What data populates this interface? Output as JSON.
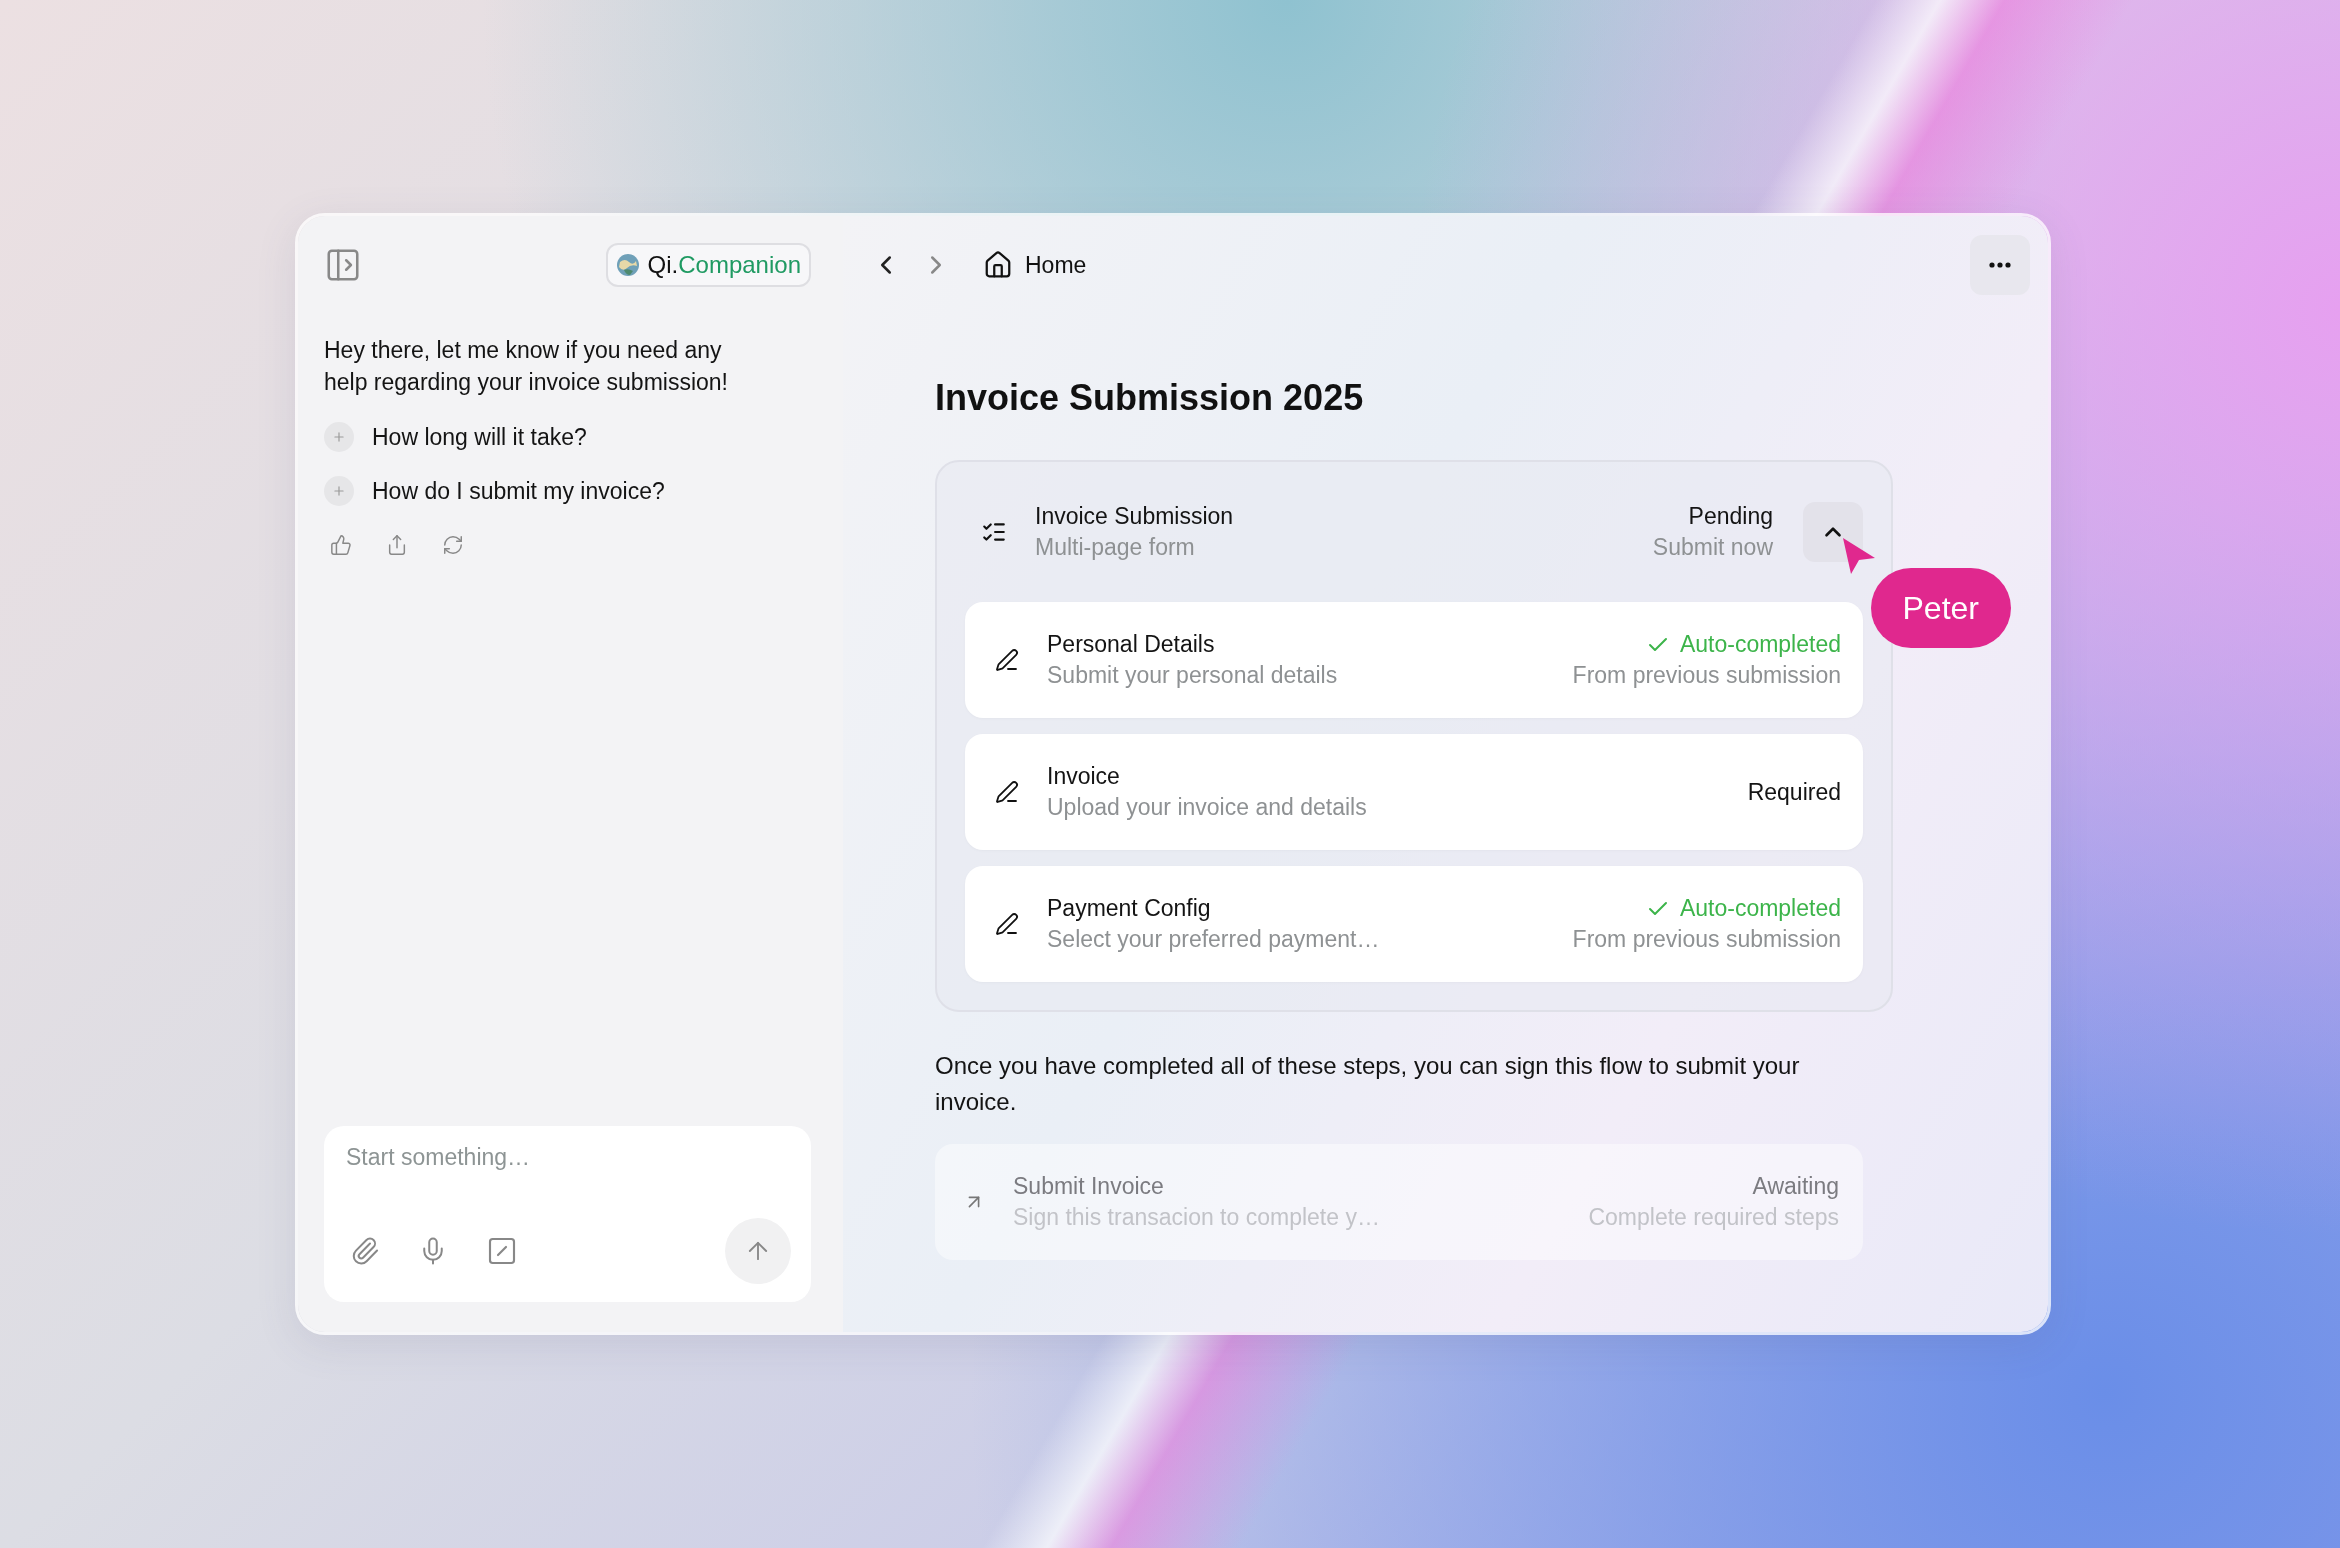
{
  "sidebar": {
    "brand": {
      "prefix": "Qi.",
      "name": "Companion"
    },
    "greeting": "Hey there, let me know if you need any help regarding your invoice submission!",
    "suggestions": [
      "How long will it take?",
      "How do I submit my invoice?"
    ],
    "composer": {
      "placeholder": "Start something…"
    }
  },
  "nav": {
    "breadcrumb": "Home"
  },
  "title": "Invoice Submission 2025",
  "form": {
    "title": "Invoice Submission",
    "subtitle": "Multi-page form",
    "status": "Pending",
    "note": "Submit now",
    "expanded": true,
    "steps": [
      {
        "kind": "done",
        "title": "Personal Details",
        "subtitle": "Submit your personal details",
        "status": "Auto-completed",
        "note": "From previous submission"
      },
      {
        "kind": "required",
        "title": "Invoice",
        "subtitle": "Upload your invoice and details",
        "status": "Required"
      },
      {
        "kind": "done",
        "title": "Payment Config",
        "subtitle": "Select your preferred payment…",
        "status": "Auto-completed",
        "note": "From previous submission"
      }
    ]
  },
  "collaborator": {
    "name": "Peter",
    "color": "#e0288e"
  },
  "message": "Once you have completed all of these steps, you can sign this flow to submit your invoice.",
  "final_step": {
    "title": "Submit Invoice",
    "subtitle": "Sign this transacion to complete y…",
    "status": "Awaiting",
    "note": "Complete required steps",
    "disabled": true
  }
}
